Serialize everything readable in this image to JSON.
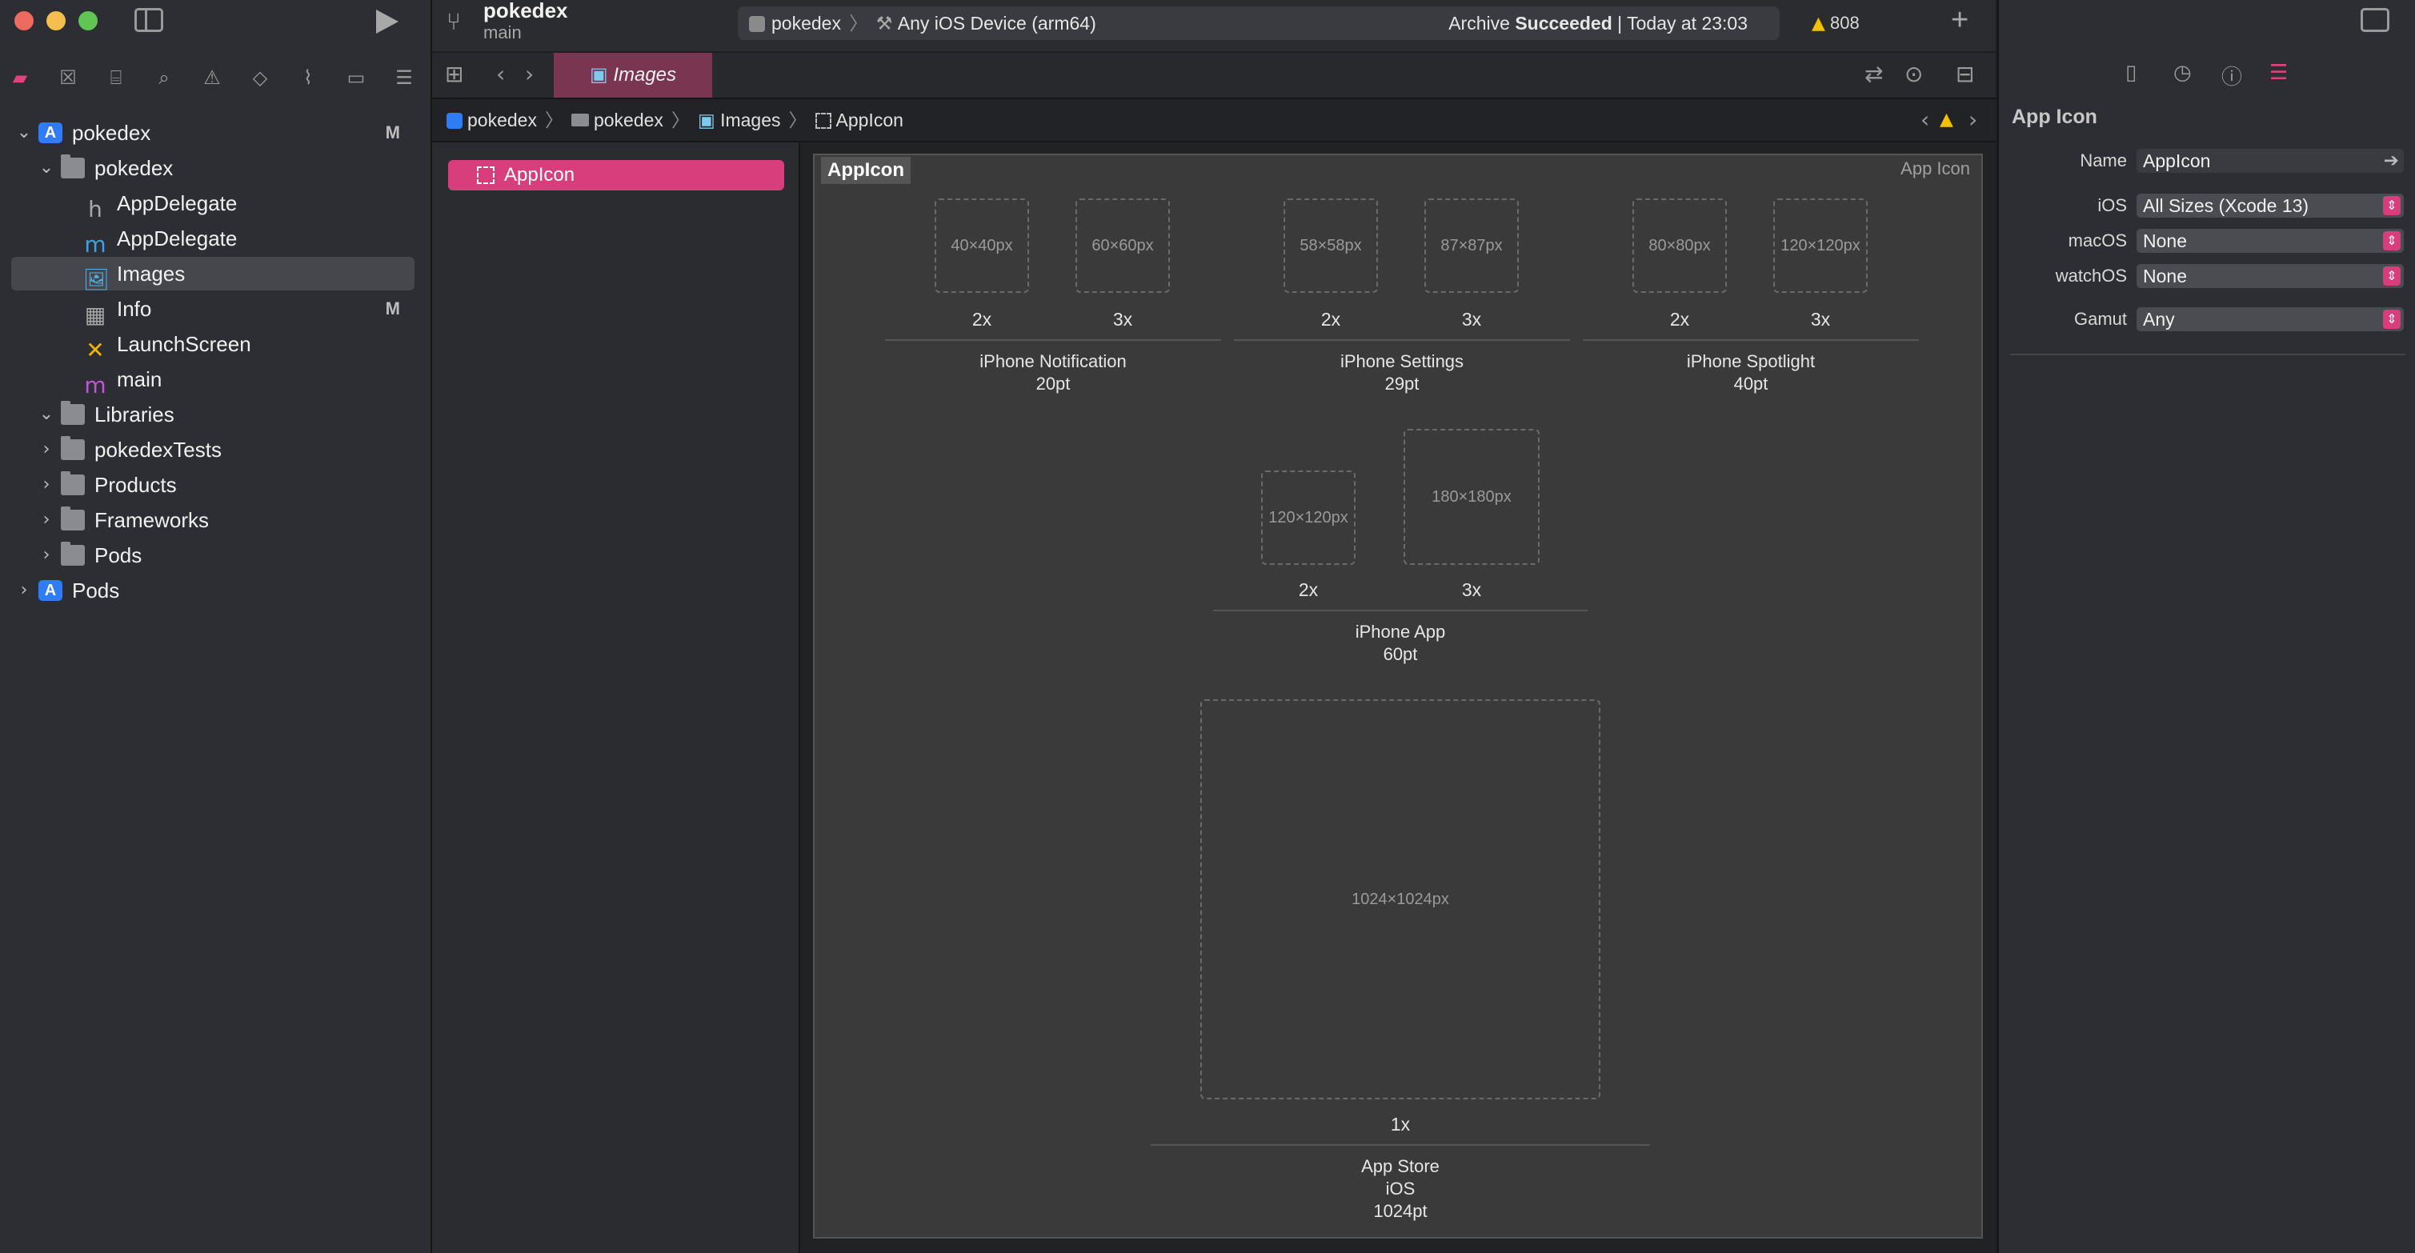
{
  "project": {
    "name": "pokedex",
    "branch": "main"
  },
  "activity": {
    "scheme": "pokedex",
    "device": "Any iOS Device (arm64)",
    "status_prefix": "Archive",
    "status_bold": "Succeeded",
    "status_time": "| Today at 23:03",
    "warnings": "808"
  },
  "tab": {
    "label": "Images"
  },
  "breadcrumb": [
    "pokedex",
    "pokedex",
    "Images",
    "AppIcon"
  ],
  "navigator": {
    "items": [
      {
        "label": "pokedex",
        "badge": "M"
      },
      {
        "label": "pokedex"
      },
      {
        "label": "AppDelegate",
        "icon": "h"
      },
      {
        "label": "AppDelegate",
        "icon": "m"
      },
      {
        "label": "Images"
      },
      {
        "label": "Info",
        "badge": "M"
      },
      {
        "label": "LaunchScreen"
      },
      {
        "label": "main",
        "icon": "m"
      },
      {
        "label": "Libraries"
      },
      {
        "label": "pokedexTests"
      },
      {
        "label": "Products"
      },
      {
        "label": "Frameworks"
      },
      {
        "label": "Pods"
      },
      {
        "label": "Pods"
      }
    ]
  },
  "asset_list": {
    "selected": "AppIcon"
  },
  "editor": {
    "title": "AppIcon",
    "type": "App Icon",
    "groups": [
      {
        "slots": [
          {
            "size": "40×40px",
            "scale": "2x"
          },
          {
            "size": "60×60px",
            "scale": "3x"
          }
        ],
        "label1": "iPhone Notification",
        "label2": "20pt"
      },
      {
        "slots": [
          {
            "size": "58×58px",
            "scale": "2x"
          },
          {
            "size": "87×87px",
            "scale": "3x"
          }
        ],
        "label1": "iPhone Settings",
        "label2": "29pt"
      },
      {
        "slots": [
          {
            "size": "80×80px",
            "scale": "2x"
          },
          {
            "size": "120×120px",
            "scale": "3x"
          }
        ],
        "label1": "iPhone Spotlight",
        "label2": "40pt"
      },
      {
        "slots": [
          {
            "size": "120×120px",
            "scale": "2x"
          },
          {
            "size": "180×180px",
            "scale": "3x"
          }
        ],
        "label1": "iPhone App",
        "label2": "60pt"
      },
      {
        "slots": [
          {
            "size": "1024×1024px",
            "scale": "1x"
          }
        ],
        "label1": "App Store",
        "label2": "iOS",
        "label3": "1024pt"
      }
    ]
  },
  "inspector": {
    "heading": "App Icon",
    "name_label": "Name",
    "name_value": "AppIcon",
    "ios_label": "iOS",
    "ios_value": "All Sizes (Xcode 13)",
    "macos_label": "macOS",
    "macos_value": "None",
    "watchos_label": "watchOS",
    "watchos_value": "None",
    "gamut_label": "Gamut",
    "gamut_value": "Any"
  },
  "colors": {
    "accent": "#d83e7b",
    "folder": "#8a8c91",
    "project": "#2f7cf6",
    "warning": "#f2c200"
  }
}
